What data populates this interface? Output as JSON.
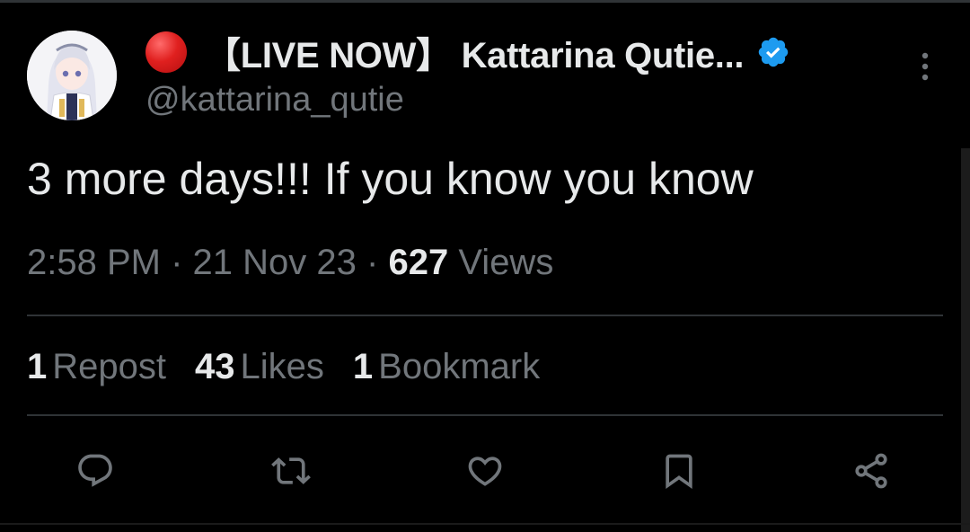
{
  "author": {
    "status_emoji": "red-circle",
    "display_name": "【LIVE NOW】 Kattarina Qutie...",
    "handle": "@kattarina_qutie",
    "verified": true,
    "verified_color": "#1d9bf0"
  },
  "tweet": {
    "text": "3 more days!!! If you know you know",
    "time": "2:58 PM",
    "date": "21 Nov 23",
    "separator": "·",
    "views_count": "627",
    "views_label": "Views"
  },
  "stats": {
    "reposts_count": "1",
    "reposts_label": "Repost",
    "likes_count": "43",
    "likes_label": "Likes",
    "bookmarks_count": "1",
    "bookmarks_label": "Bookmark"
  },
  "actions": [
    {
      "icon": "reply-icon"
    },
    {
      "icon": "repost-icon"
    },
    {
      "icon": "like-icon"
    },
    {
      "icon": "bookmark-icon"
    },
    {
      "icon": "share-icon"
    }
  ],
  "colors": {
    "background": "#000000",
    "primary_text": "#e7e9ea",
    "secondary_text": "#71767b",
    "divider": "#2f3336",
    "status_red": "#e0201f"
  }
}
